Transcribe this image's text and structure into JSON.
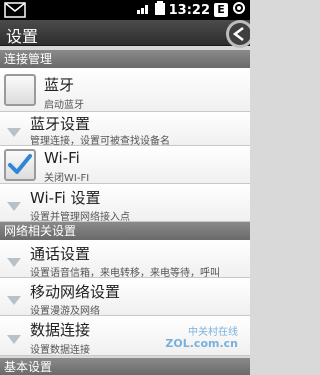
{
  "status": {
    "time": "13:22",
    "badge": "E"
  },
  "title": "设置",
  "sections": {
    "connect": "连接管理",
    "network": "网络相关设置",
    "basic": "基本设置"
  },
  "rows": {
    "bt": {
      "title": "蓝牙",
      "sub": "启动蓝牙",
      "checked": false
    },
    "bt_settings": {
      "title": "蓝牙设置",
      "sub": "管理连接，设置可被查找设备名"
    },
    "wifi": {
      "title": "Wi-Fi",
      "sub": "关闭WI-FI",
      "checked": true
    },
    "wifi_settings": {
      "title": "Wi-Fi 设置",
      "sub": "设置并管理网络接入点"
    },
    "call_settings": {
      "title": "通话设置",
      "sub": "设置语音信箱，来电转移，来电等待，呼叫"
    },
    "mobile_net": {
      "title": "移动网络设置",
      "sub": "设置漫游及网络"
    },
    "data_conn": {
      "title": "数据连接",
      "sub": "设置数据连接"
    }
  },
  "watermark": {
    "line1": "中关村在线",
    "line2": "ZOL.com.cn"
  },
  "colors": {
    "accent_blue": "#2f86d6",
    "section_bg": "#7b7b7b"
  }
}
